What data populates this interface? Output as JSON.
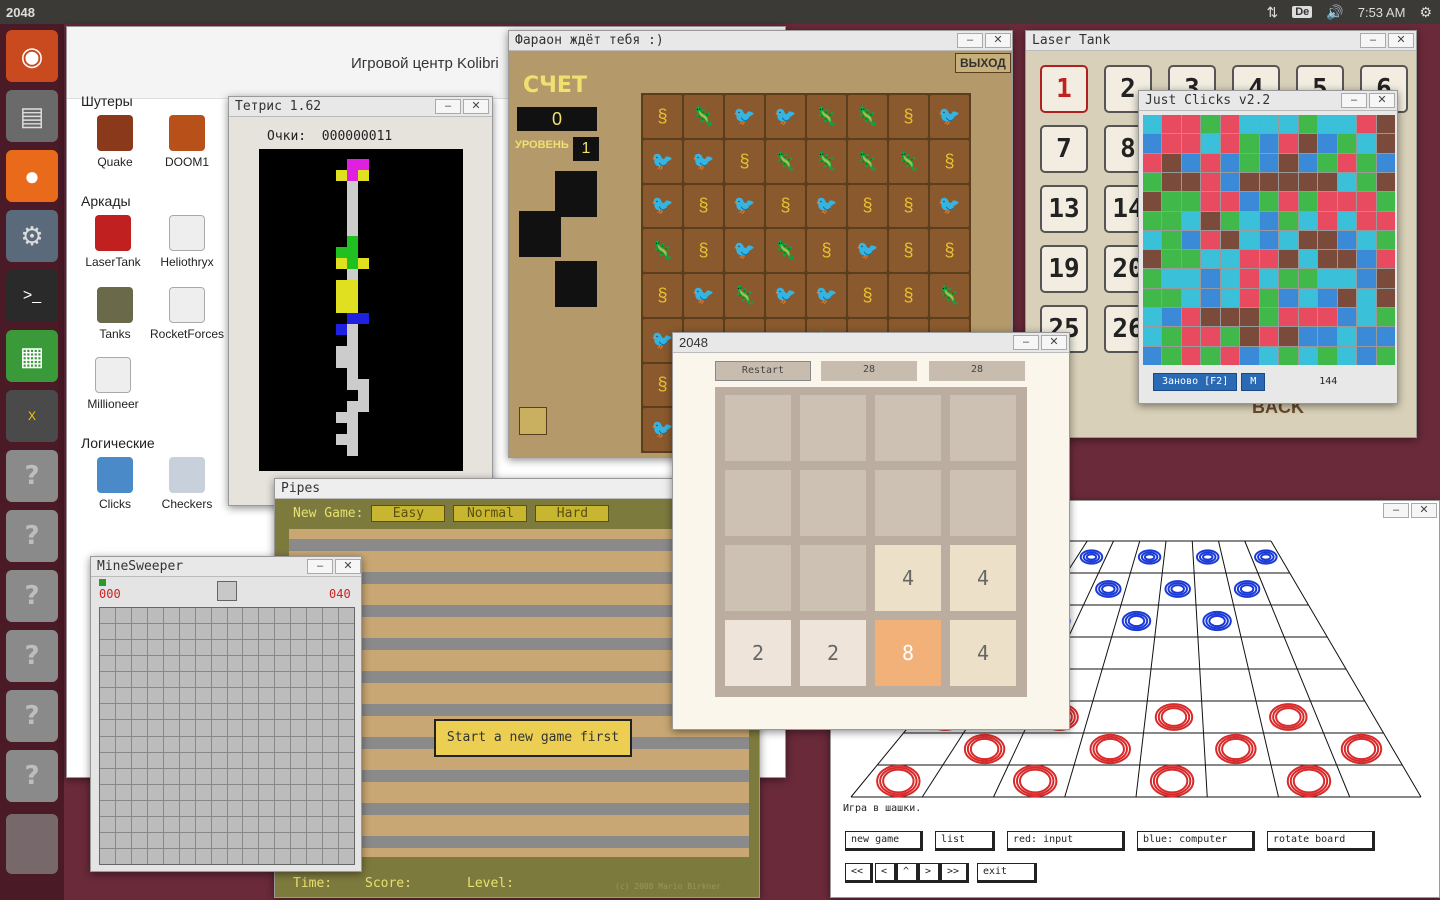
{
  "topbar": {
    "title": "2048",
    "keyboard": "De",
    "time": "7:53 AM"
  },
  "game_center": {
    "title": "Игровой центр Kolibri",
    "categories": [
      "Шутеры",
      "Аркады",
      "Логические"
    ],
    "shooters": [
      "Quake",
      "DOOM1"
    ],
    "arcades": [
      "LaserTank",
      "Heliothryx",
      "Tanks",
      "RocketForces",
      "Millioneer"
    ],
    "logic": [
      "Clicks",
      "Checkers"
    ]
  },
  "tetris": {
    "title": "Тетрис 1.62",
    "score_label": "Очки:",
    "score": "000000011"
  },
  "pharaoh": {
    "title": "Фараон ждёт тебя :)",
    "score_label": "СЧЕТ",
    "score": "0",
    "level_label": "УРОВЕНЬ",
    "level": "1",
    "exit": "ВЫХОД"
  },
  "laser_tank": {
    "title": "Laser Tank",
    "levels": [
      "1",
      "2",
      "3",
      "4",
      "5",
      "6",
      "7",
      "8",
      "13",
      "14",
      "19",
      "20",
      "25",
      "26"
    ],
    "back": "BACK"
  },
  "just_clicks": {
    "title": "Just Clicks v2.2",
    "restart": "Заново [F2]",
    "menu": "M",
    "count": "144"
  },
  "checkers": {
    "caption": "Игра в шашки.",
    "buttons": [
      "new game",
      "list",
      "red: input",
      "blue: computer",
      "rotate board"
    ],
    "nav": [
      "<<",
      "<",
      "^",
      ">",
      ">>"
    ],
    "exit": "exit"
  },
  "pipes": {
    "title": "Pipes",
    "new_game_label": "New Game:",
    "modes": [
      "Easy",
      "Normal",
      "Hard"
    ],
    "message": "Start a new game first",
    "time_label": "Time:",
    "score_label": "Score:",
    "level_label": "Level:",
    "credit": "(c) 2008 Mario Birkner"
  },
  "minesweeper": {
    "title": "MineSweeper",
    "left_counter": "000",
    "right_counter": "040"
  },
  "game2048": {
    "title": "2048",
    "restart": "Restart",
    "score": "28",
    "best": "28",
    "board": [
      [
        "",
        "",
        "",
        ""
      ],
      [
        "",
        "",
        "",
        ""
      ],
      [
        "",
        "",
        "4",
        "4"
      ],
      [
        "2",
        "2",
        "8",
        "4"
      ]
    ]
  },
  "colors": {
    "tile_2": "#eee4da",
    "tile_4": "#ede0c8",
    "tile_8": "#f2b179"
  }
}
